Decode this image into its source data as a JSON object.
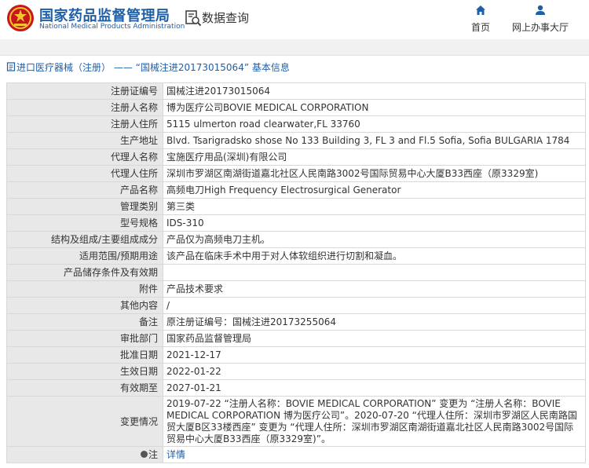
{
  "header": {
    "org_name_cn": "国家药品监督管理局",
    "org_name_en": "National Medical Products Administration",
    "query_title": "数据查询",
    "nav": [
      {
        "label": "首页",
        "icon": "home-icon"
      },
      {
        "label": "网上办事大厅",
        "icon": "user-icon"
      }
    ]
  },
  "breadcrumb": "进口医疗器械（注册） —— “国械注进20173015064” 基本信息",
  "rows": [
    {
      "label": "注册证编号",
      "value": "国械注进20173015064"
    },
    {
      "label": "注册人名称",
      "value": "博为医疗公司BOVIE MEDICAL CORPORATION"
    },
    {
      "label": "注册人住所",
      "value": "5115 ulmerton road clearwater,FL 33760"
    },
    {
      "label": "生产地址",
      "value": "Blvd. Tsarigradsko shose No 133 Building 3, FL 3 and Fl.5 Sofia, Sofia BULGARIA 1784"
    },
    {
      "label": "代理人名称",
      "value": "宝施医疗用品(深圳)有限公司"
    },
    {
      "label": "代理人住所",
      "value": "深圳市罗湖区南湖街道嘉北社区人民南路3002号国际贸易中心大厦B33西座（原3329室)"
    },
    {
      "label": "产品名称",
      "value": "高频电刀High Frequency Electrosurgical Generator"
    },
    {
      "label": "管理类别",
      "value": "第三类"
    },
    {
      "label": "型号规格",
      "value": "IDS-310"
    },
    {
      "label": "结构及组成/主要组成成分",
      "value": "产品仅为高频电刀主机。"
    },
    {
      "label": "适用范围/预期用途",
      "value": "该产品在临床手术中用于对人体软组织进行切割和凝血。"
    },
    {
      "label": "产品储存条件及有效期",
      "value": ""
    },
    {
      "label": "附件",
      "value": "产品技术要求"
    },
    {
      "label": "其他内容",
      "value": "/"
    },
    {
      "label": "备注",
      "value": "原注册证编号：国械注进20173255064"
    },
    {
      "label": "审批部门",
      "value": "国家药品监督管理局"
    },
    {
      "label": "批准日期",
      "value": "2021-12-17"
    },
    {
      "label": "生效日期",
      "value": "2022-01-22"
    },
    {
      "label": "有效期至",
      "value": "2027-01-21"
    }
  ],
  "change": {
    "label": "变更情况",
    "value": "2019-07-22 “注册人名称：BOVIE MEDICAL CORPORATION” 变更为 “注册人名称：BOVIE MEDICAL CORPORATION 博为医疗公司”。2020-07-20 “代理人住所：深圳市罗湖区人民南路国贸大厦B区33楼西座” 变更为 “代理人住所：深圳市罗湖区南湖街道嘉北社区人民南路3002号国际贸易中心大厦B33西座（原3329室)”。"
  },
  "note": {
    "label": "注",
    "link": "详情"
  },
  "colors": {
    "brand_blue": "#1f5fa6",
    "label_bg": "#e8e8e8",
    "border": "#d8d8d8"
  }
}
